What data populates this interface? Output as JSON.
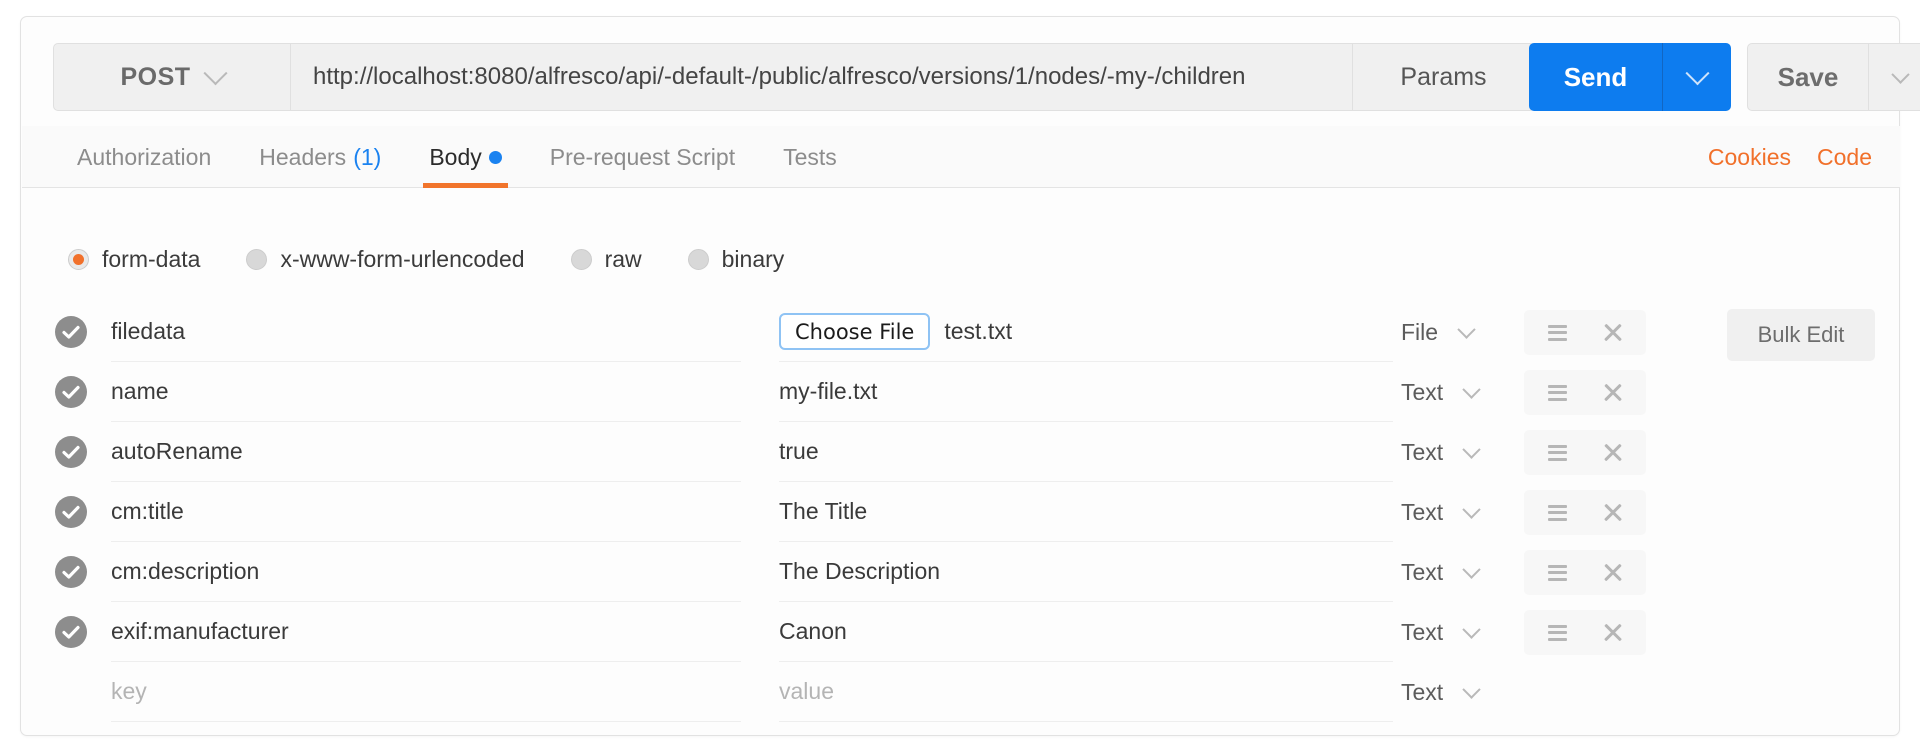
{
  "request": {
    "method": "POST",
    "url": "http://localhost:8080/alfresco/api/-default-/public/alfresco/versions/1/nodes/-my-/children",
    "params_label": "Params",
    "send_label": "Send",
    "save_label": "Save"
  },
  "tabs": [
    {
      "label": "Authorization",
      "count": "",
      "dot": false,
      "active": false
    },
    {
      "label": "Headers",
      "count": "(1)",
      "dot": false,
      "active": false
    },
    {
      "label": "Body",
      "count": "",
      "dot": true,
      "active": true
    },
    {
      "label": "Pre-request Script",
      "count": "",
      "dot": false,
      "active": false
    },
    {
      "label": "Tests",
      "count": "",
      "dot": false,
      "active": false
    }
  ],
  "tabs_right": {
    "cookies_label": "Cookies",
    "code_label": "Code"
  },
  "body_modes": [
    {
      "label": "form-data",
      "selected": true
    },
    {
      "label": "x-www-form-urlencoded",
      "selected": false
    },
    {
      "label": "raw",
      "selected": false
    },
    {
      "label": "binary",
      "selected": false
    }
  ],
  "form_data": {
    "key_placeholder": "key",
    "value_placeholder": "value",
    "choose_file_label": "Choose File",
    "bulk_edit_label": "Bulk Edit",
    "rows": [
      {
        "checked": true,
        "key": "filedata",
        "value": "test.txt",
        "is_file": true,
        "type": "File",
        "actions": true
      },
      {
        "checked": true,
        "key": "name",
        "value": "my-file.txt",
        "is_file": false,
        "type": "Text",
        "actions": true
      },
      {
        "checked": true,
        "key": "autoRename",
        "value": "true",
        "is_file": false,
        "type": "Text",
        "actions": true
      },
      {
        "checked": true,
        "key": "cm:title",
        "value": "The Title",
        "is_file": false,
        "type": "Text",
        "actions": true
      },
      {
        "checked": true,
        "key": "cm:description",
        "value": "The Description",
        "is_file": false,
        "type": "Text",
        "actions": true
      },
      {
        "checked": true,
        "key": "exif:manufacturer",
        "value": "Canon",
        "is_file": false,
        "type": "Text",
        "actions": true
      },
      {
        "checked": false,
        "key": "",
        "value": "",
        "is_file": false,
        "type": "Text",
        "actions": false
      }
    ]
  },
  "colors": {
    "accent_orange": "#f1702a",
    "accent_blue": "#0d7cef",
    "check_gray": "#8d8d8d"
  }
}
